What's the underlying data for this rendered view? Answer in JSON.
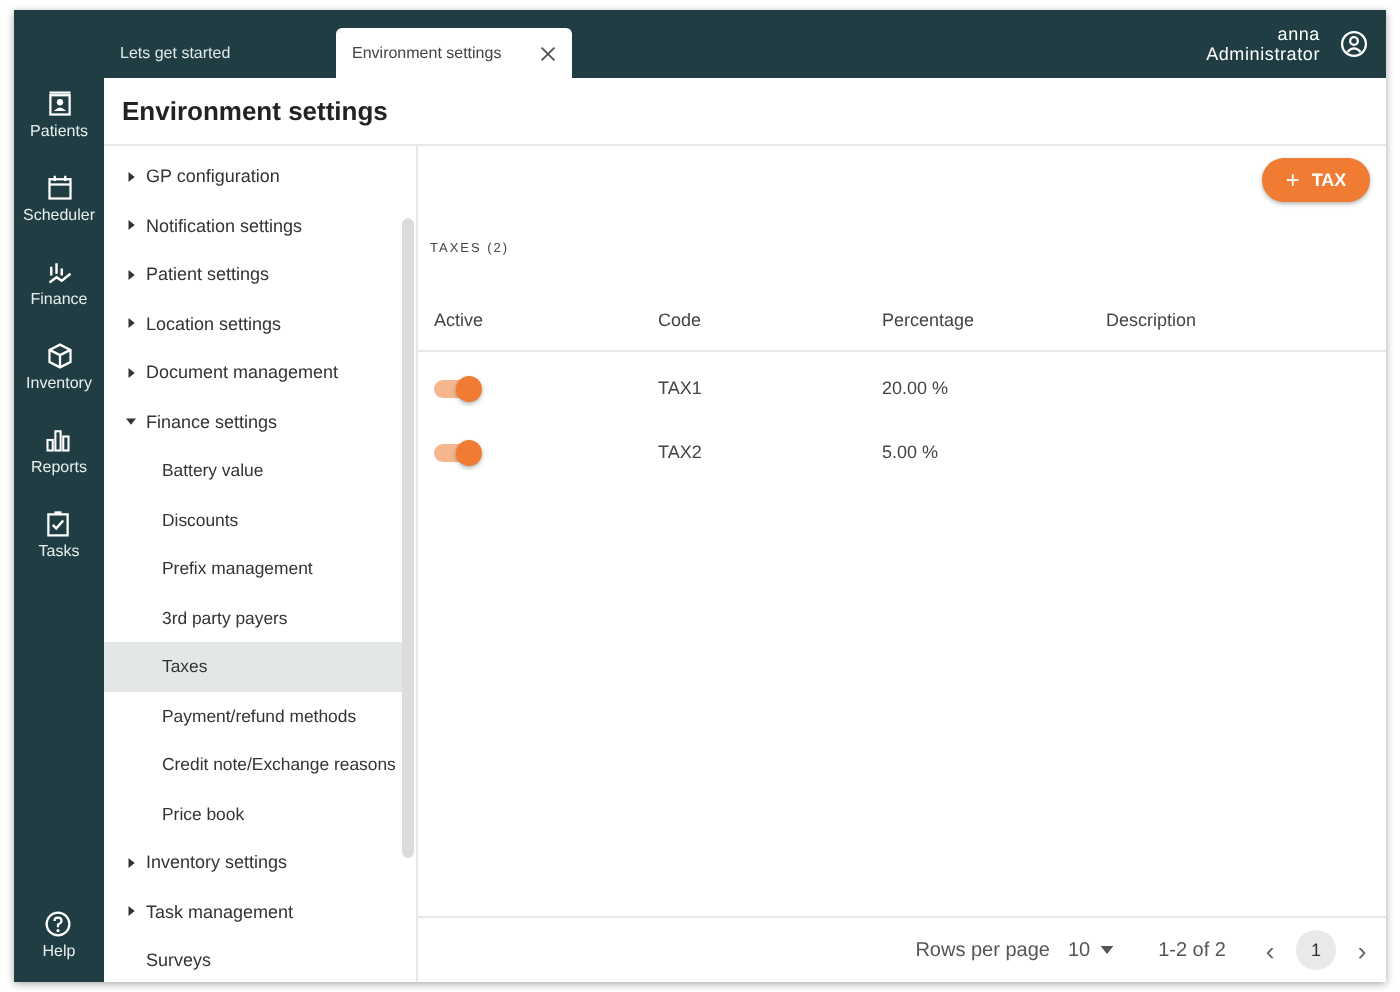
{
  "rail": {
    "items": [
      {
        "label": "Patients"
      },
      {
        "label": "Scheduler"
      },
      {
        "label": "Finance"
      },
      {
        "label": "Inventory"
      },
      {
        "label": "Reports"
      },
      {
        "label": "Tasks"
      }
    ],
    "help": {
      "label": "Help"
    }
  },
  "tabs": [
    {
      "label": "Lets get started",
      "selected": false
    },
    {
      "label": "Environment settings",
      "selected": true
    }
  ],
  "user": {
    "name": "anna",
    "role": "Administrator"
  },
  "page_title": "Environment settings",
  "nav": [
    {
      "label": "GP configuration",
      "expanded": false,
      "selected": false
    },
    {
      "label": "Notification settings",
      "expanded": false,
      "selected": false
    },
    {
      "label": "Patient settings",
      "expanded": false,
      "selected": false
    },
    {
      "label": "Location settings",
      "expanded": false,
      "selected": false
    },
    {
      "label": "Document management",
      "expanded": false,
      "selected": false
    },
    {
      "label": "Finance settings",
      "expanded": true,
      "selected": false,
      "children": [
        {
          "label": "Battery value",
          "selected": false
        },
        {
          "label": "Discounts",
          "selected": false
        },
        {
          "label": "Prefix management",
          "selected": false
        },
        {
          "label": "3rd party payers",
          "selected": false
        },
        {
          "label": "Taxes",
          "selected": true
        },
        {
          "label": "Payment/refund methods",
          "selected": false
        },
        {
          "label": "Credit note/Exchange reasons",
          "selected": false
        },
        {
          "label": "Price book",
          "selected": false
        }
      ]
    },
    {
      "label": "Inventory settings",
      "expanded": false,
      "selected": false
    },
    {
      "label": "Task management",
      "expanded": false,
      "selected": false
    },
    {
      "label": "Surveys",
      "selected": false
    }
  ],
  "add_button": {
    "icon": "+",
    "label": "TAX"
  },
  "section_title": "TAXES (2)",
  "table": {
    "columns": [
      "Active",
      "Code",
      "Percentage",
      "Description"
    ],
    "rows": [
      {
        "active": true,
        "code": "TAX1",
        "percentage": "20.00 %"
      },
      {
        "active": true,
        "code": "TAX2",
        "percentage": "5.00 %"
      }
    ]
  },
  "pagination": {
    "rows_per_page_label": "Rows per page",
    "rows_per_page": "10",
    "range": "1-2 of 2",
    "prev": "‹",
    "next": "›",
    "pages": [
      {
        "label": "1",
        "selected": true
      }
    ]
  }
}
